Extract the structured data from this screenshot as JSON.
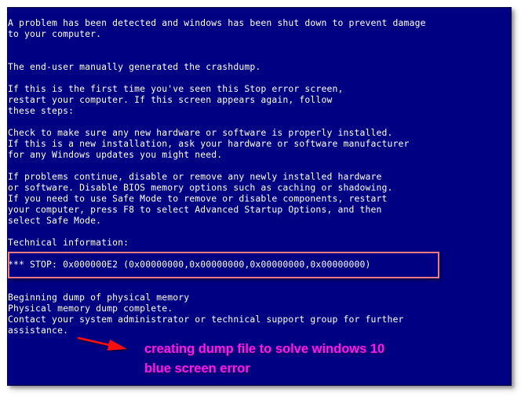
{
  "screen": {
    "type": "Windows Stop error (blue screen)",
    "background_color": "#000082",
    "text_color": "#ffffff"
  },
  "bsod": {
    "intro": "A problem has been detected and windows has been shut down to prevent damage\nto your computer.",
    "cause": "The end-user manually generated the crashdump.",
    "first_time": "If this is the first time you've seen this Stop error screen,\nrestart your computer. If this screen appears again, follow\nthese steps:",
    "check": "Check to make sure any new hardware or software is properly installed.\nIf this is a new installation, ask your hardware or software manufacturer\nfor any Windows updates you might need.",
    "problems": "If problems continue, disable or remove any newly installed hardware\nor software. Disable BIOS memory options such as caching or shadowing.\nIf you need to use Safe Mode to remove or disable components, restart\nyour computer, press F8 to select Advanced Startup Options, and then\nselect Safe Mode.",
    "tech_heading": "Technical information:",
    "stop_code": "*** STOP: 0x000000E2 (0x00000000,0x00000000,0x00000000,0x00000000)",
    "dump": "Beginning dump of physical memory\nPhysical memory dump complete.\nContact your system administrator or technical support group for further\nassistance."
  },
  "annotation": {
    "text": "creating dump file to solve windows 10\nblue screen error",
    "text_color": "#ff14ff",
    "highlight_box_color": "#f07a84",
    "arrow_color": "#ff1010",
    "arrow_icon": "red-arrow"
  }
}
